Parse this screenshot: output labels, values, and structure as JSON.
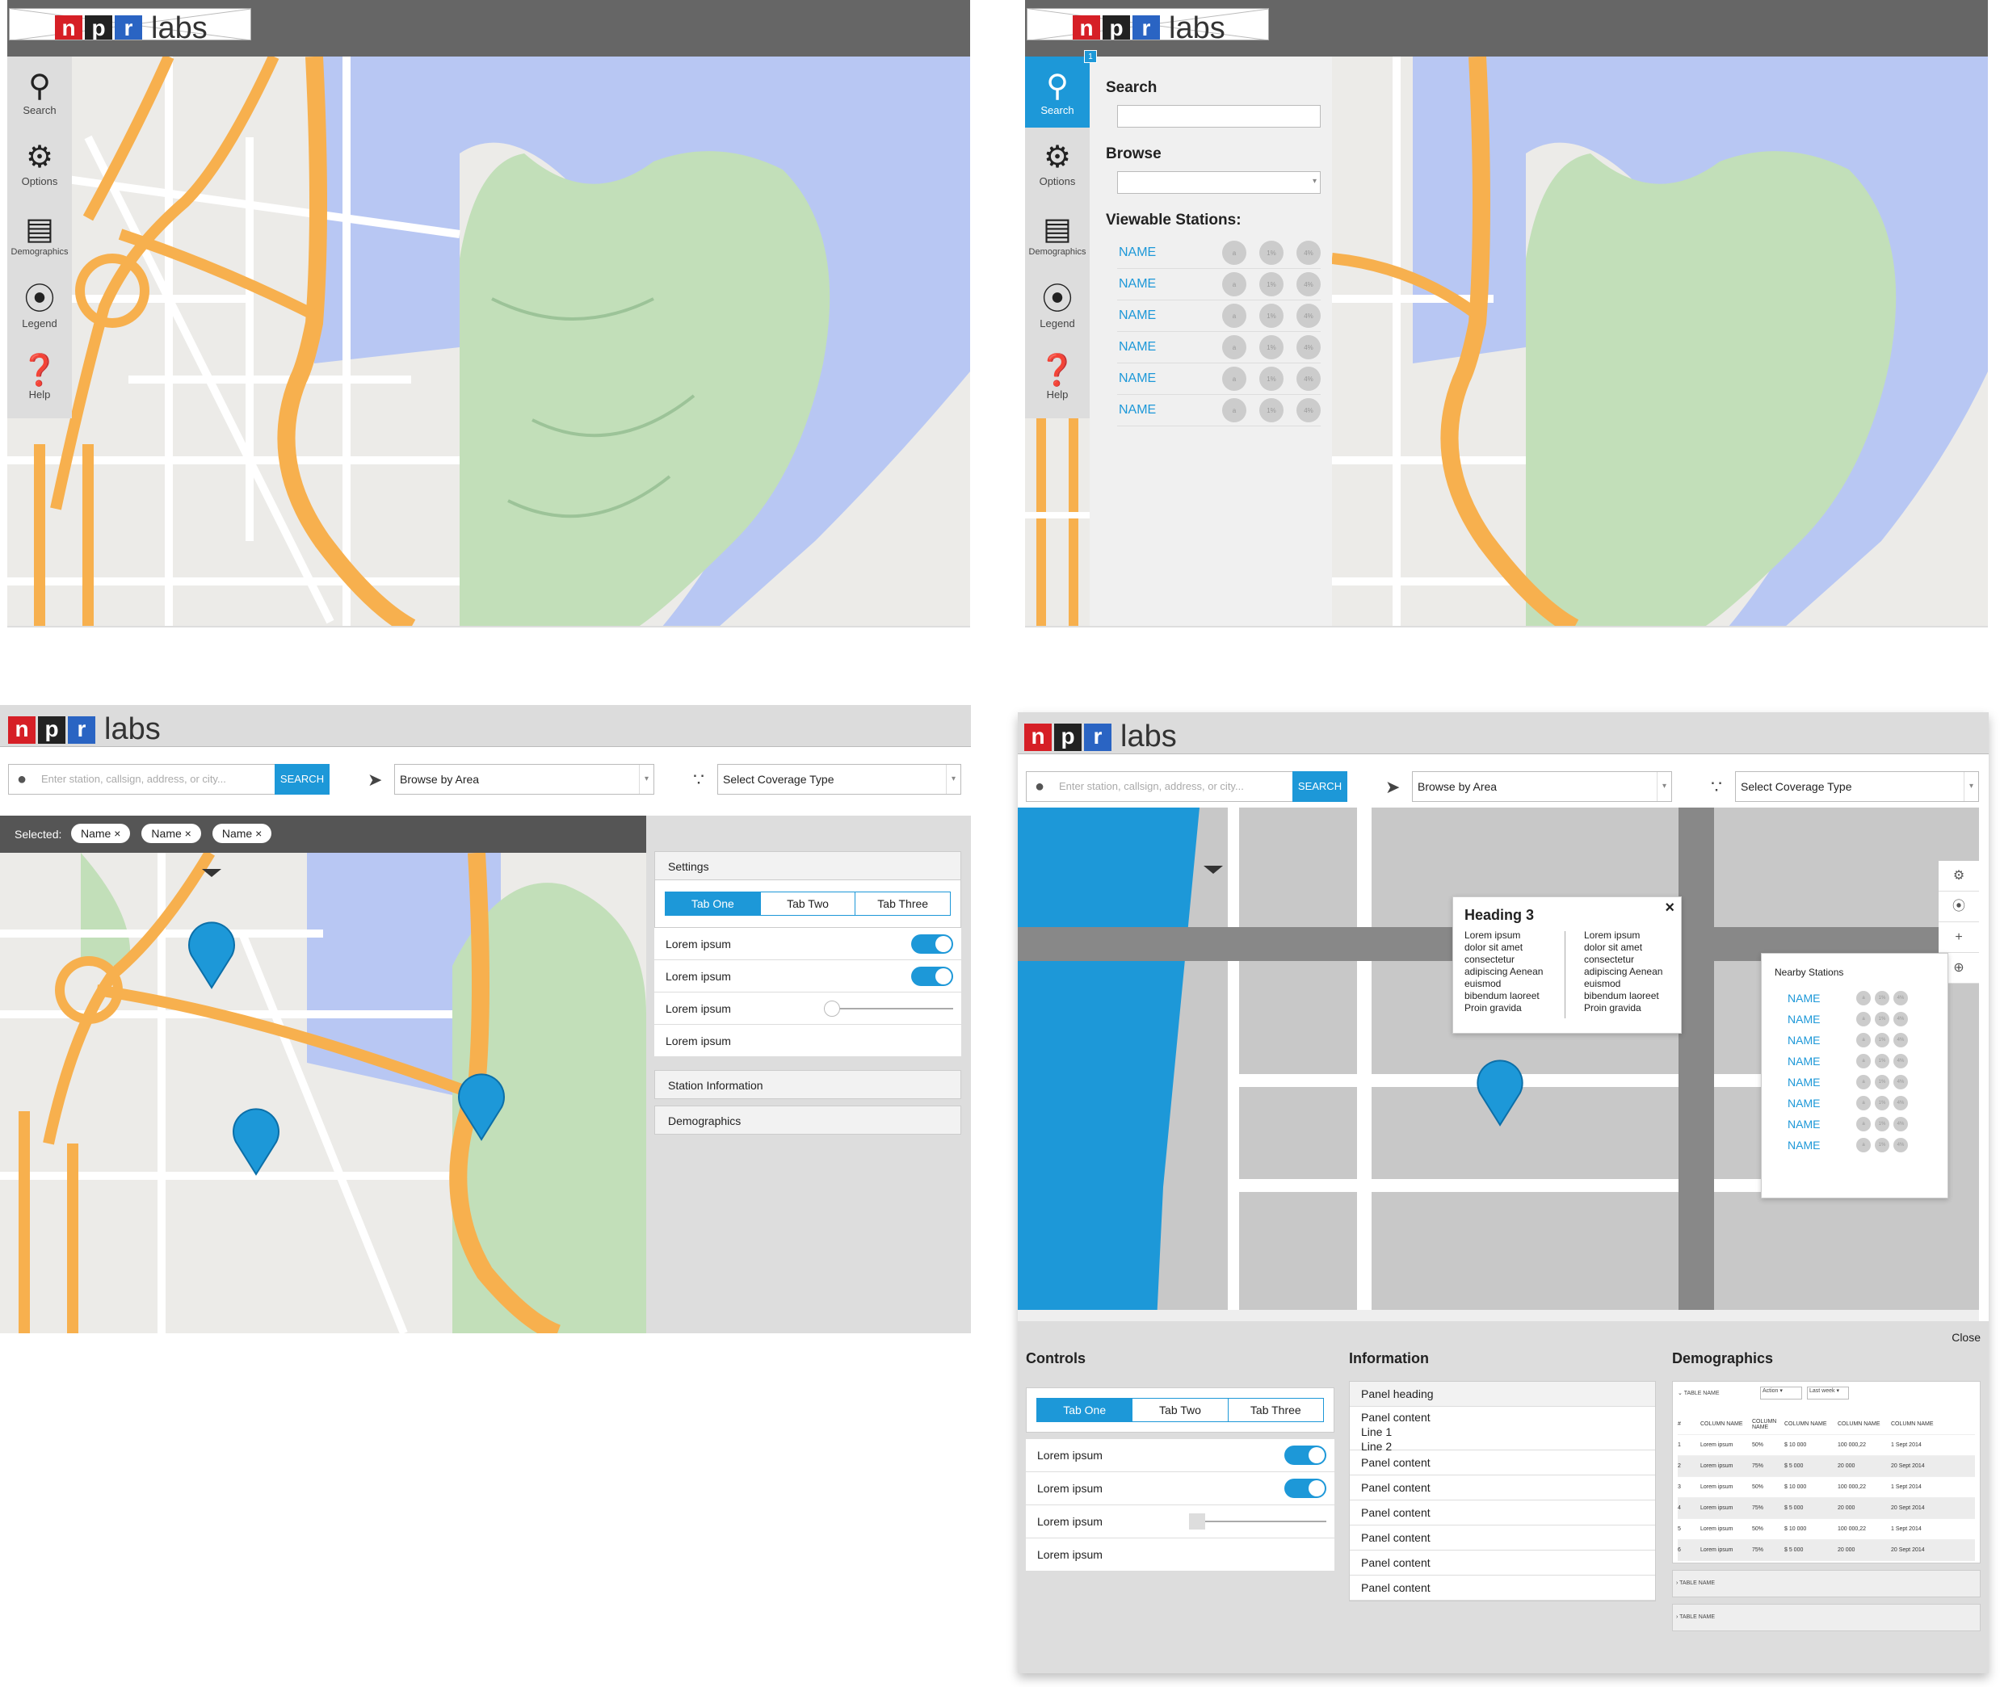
{
  "logo": {
    "n": "n",
    "p": "p",
    "r": "r",
    "labs": "labs"
  },
  "sidebar": {
    "items": [
      {
        "label": "Search",
        "icon": "search-icon"
      },
      {
        "label": "Options",
        "icon": "gear-icon"
      },
      {
        "label": "Demographics",
        "icon": "bar-chart-icon"
      },
      {
        "label": "Legend",
        "icon": "compass-icon"
      },
      {
        "label": "Help",
        "icon": "help-icon"
      }
    ]
  },
  "search_panel": {
    "badge": "1",
    "search_heading": "Search",
    "browse_heading": "Browse",
    "viewable_heading": "Viewable Stations:",
    "stations": [
      "NAME",
      "NAME",
      "NAME",
      "NAME",
      "NAME",
      "NAME"
    ],
    "dot_labels": [
      "a",
      "1%",
      "4%"
    ]
  },
  "toolbar": {
    "search_placeholder": "Enter station, callsign, address, or city...",
    "search_button": "SEARCH",
    "browse_select": "Browse by Area",
    "coverage_select": "Select Coverage Type"
  },
  "selected": {
    "label": "Selected:",
    "chips": [
      "Name ×",
      "Name ×",
      "Name ×"
    ]
  },
  "settings_panel": {
    "settings": "Settings",
    "tabs": [
      "Tab One",
      "Tab Two",
      "Tab Three"
    ],
    "rows": [
      "Lorem ipsum",
      "Lorem ipsum",
      "Lorem ipsum",
      "Lorem ipsum"
    ],
    "station_information": "Station Information",
    "demographics": "Demographics"
  },
  "popup": {
    "heading": "Heading 3",
    "close": "×",
    "col1": [
      "Lorem ipsum",
      "dolor sit amet",
      "consectetur",
      "adipiscing Aenean",
      "euismod",
      "bibendum laoreet",
      "Proin gravida"
    ],
    "col2": [
      "Lorem ipsum",
      "dolor sit amet",
      "consectetur",
      "adipiscing Aenean",
      "euismod",
      "bibendum laoreet",
      "Proin gravida"
    ]
  },
  "nearby": {
    "title": "Nearby Stations",
    "stations": [
      "NAME",
      "NAME",
      "NAME",
      "NAME",
      "NAME",
      "NAME",
      "NAME",
      "NAME"
    ]
  },
  "bottom": {
    "close": "Close",
    "controls_title": "Controls",
    "information_title": "Information",
    "demographics_title": "Demographics",
    "tabs": [
      "Tab One",
      "Tab Two",
      "Tab Three"
    ],
    "control_rows": [
      "Lorem ipsum",
      "Lorem ipsum",
      "Lorem ipsum",
      "Lorem ipsum"
    ],
    "panel_heading": "Panel heading",
    "panel_content_first": [
      "Panel content",
      "Line 1",
      "Line 2"
    ],
    "panel_content": [
      "Panel content",
      "Panel content",
      "Panel content",
      "Panel content",
      "Panel content",
      "Panel content"
    ],
    "table": {
      "name": "TABLE NAME",
      "action": "Action",
      "range": "Last week",
      "columns": [
        "#",
        "COLUMN NAME",
        "COLUMN NAME",
        "COLUMN NAME",
        "COLUMN NAME",
        "COLUMN NAME"
      ],
      "rows": [
        [
          "1",
          "Lorem ipsum",
          "50%",
          "$ 10 000",
          "100 000,22",
          "1 Sept 2014"
        ],
        [
          "2",
          "Lorem ipsum",
          "75%",
          "$ 5 000",
          "20 000",
          "20 Sept 2014"
        ],
        [
          "3",
          "Lorem ipsum",
          "50%",
          "$ 10 000",
          "100 000,22",
          "1 Sept 2014"
        ],
        [
          "4",
          "Lorem ipsum",
          "75%",
          "$ 5 000",
          "20 000",
          "20 Sept 2014"
        ],
        [
          "5",
          "Lorem ipsum",
          "50%",
          "$ 10 000",
          "100 000,22",
          "1 Sept 2014"
        ],
        [
          "6",
          "Lorem ipsum",
          "75%",
          "$ 5 000",
          "20 000",
          "20 Sept 2014"
        ]
      ],
      "collapsed": [
        "TABLE NAME",
        "TABLE NAME"
      ]
    }
  }
}
